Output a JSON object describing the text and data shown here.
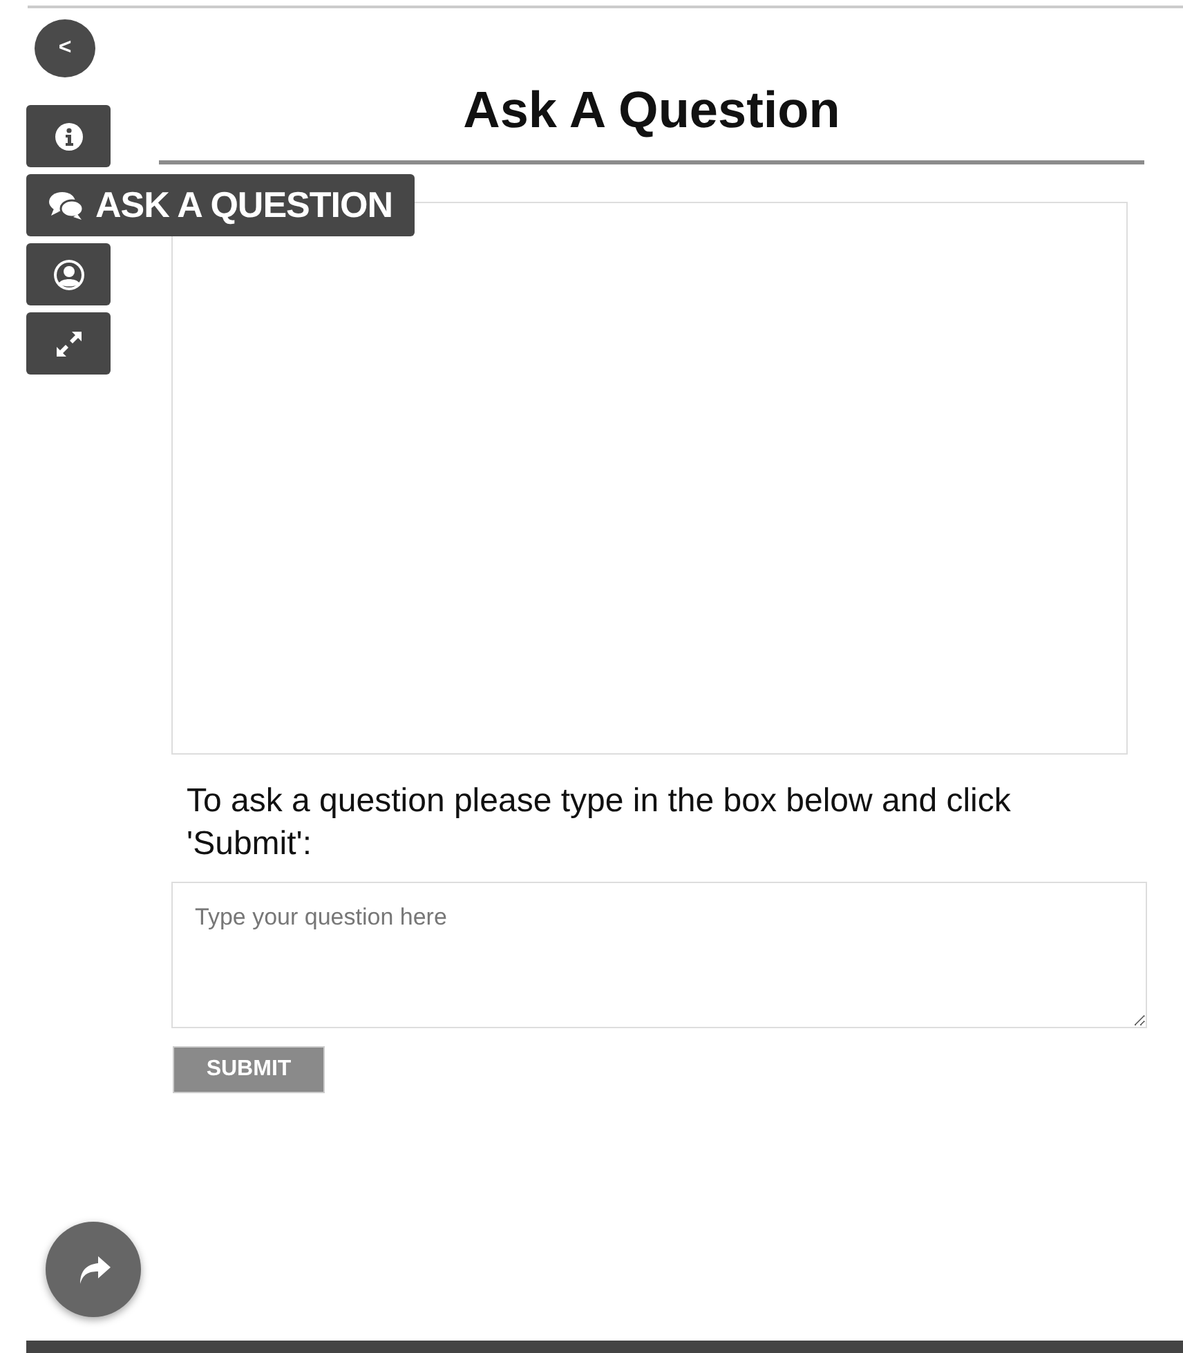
{
  "back_button": {
    "label": "<"
  },
  "sidebar": {
    "items": [
      {
        "kind": "info"
      },
      {
        "kind": "chat",
        "label": "ASK A QUESTION"
      },
      {
        "kind": "user"
      },
      {
        "kind": "expand"
      }
    ]
  },
  "title": "Ask A Question",
  "instructions": "To ask a question please type in the box below and click 'Submit':",
  "question_field": {
    "placeholder": "Type your question here"
  },
  "submit_button": {
    "label": "SUBMIT"
  },
  "share_button": {
    "kind": "share"
  }
}
